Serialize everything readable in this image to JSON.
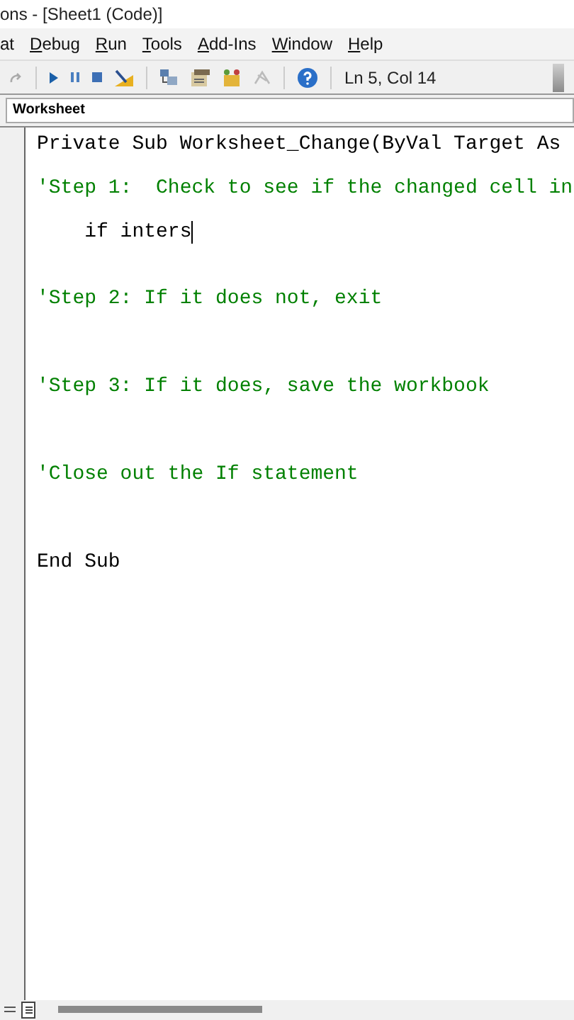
{
  "window": {
    "title": "ons - [Sheet1 (Code)]"
  },
  "menu": [
    {
      "label": "at",
      "first_underlined": false
    },
    {
      "label": "Debug",
      "first_underlined": true
    },
    {
      "label": "Run",
      "first_underlined": true
    },
    {
      "label": "Tools",
      "first_underlined": true
    },
    {
      "label": "Add-Ins",
      "first_underlined": true
    },
    {
      "label": "Window",
      "first_underlined": true
    },
    {
      "label": "Help",
      "first_underlined": true
    }
  ],
  "toolbar": {
    "position": "Ln 5, Col 14"
  },
  "object_box": {
    "value": "Worksheet"
  },
  "code": [
    {
      "kind": "code",
      "text": "Private Sub Worksheet_Change(ByVal Target As"
    },
    {
      "kind": "comment",
      "text": "'Step 1:  Check to see if the changed cell in"
    },
    {
      "kind": "code",
      "text": "    if inters",
      "cursor": true
    },
    {
      "kind": "gap"
    },
    {
      "kind": "comment",
      "text": "'Step 2: If it does not, exit"
    },
    {
      "kind": "blank"
    },
    {
      "kind": "comment",
      "text": "'Step 3: If it does, save the workbook"
    },
    {
      "kind": "blank"
    },
    {
      "kind": "comment",
      "text": "'Close out the If statement"
    },
    {
      "kind": "blank"
    },
    {
      "kind": "code",
      "text": "End Sub"
    }
  ]
}
